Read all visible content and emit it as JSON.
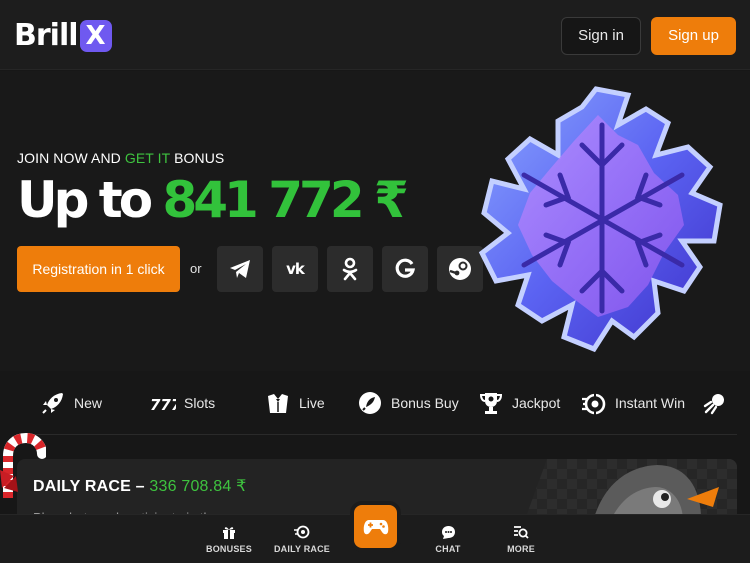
{
  "header": {
    "logo_text": "Brill",
    "logo_badge": "X",
    "sign_in": "Sign in",
    "sign_up": "Sign up"
  },
  "hero": {
    "tagline_part1": "JOIN NOW AND ",
    "tagline_highlight": "GET IT",
    "tagline_part2": " BONUS",
    "amount_prefix": "Up to ",
    "amount_value": "841 772 ₹",
    "register_button": "Registration in 1 click",
    "or_text": "or",
    "social_buttons": [
      "telegram-icon",
      "vk-icon",
      "odnoklassniki-icon",
      "google-icon",
      "steam-icon"
    ],
    "vk_glyph": "vk"
  },
  "categories": [
    {
      "label": "New",
      "icon": "rocket-icon"
    },
    {
      "label": "Slots",
      "icon": "slots-777-icon"
    },
    {
      "label": "Live",
      "icon": "dealer-icon"
    },
    {
      "label": "Bonus Buy",
      "icon": "bonus-buy-icon"
    },
    {
      "label": "Jackpot",
      "icon": "trophy-icon"
    },
    {
      "label": "Instant Win",
      "icon": "instant-win-icon"
    }
  ],
  "daily_race": {
    "title": "DAILY RACE – ",
    "amount": "336 708.84 ₹",
    "subtitle": "Place bets and participate in the"
  },
  "bottom_nav": {
    "bonuses": "BONUSES",
    "daily_race": "DAILY RACE",
    "chat": "CHAT",
    "more": "MORE"
  },
  "colors": {
    "accent_orange": "#ee7d0b",
    "accent_green": "#3ec33f",
    "logo_purple": "#6f59f0",
    "background": "#171717"
  }
}
